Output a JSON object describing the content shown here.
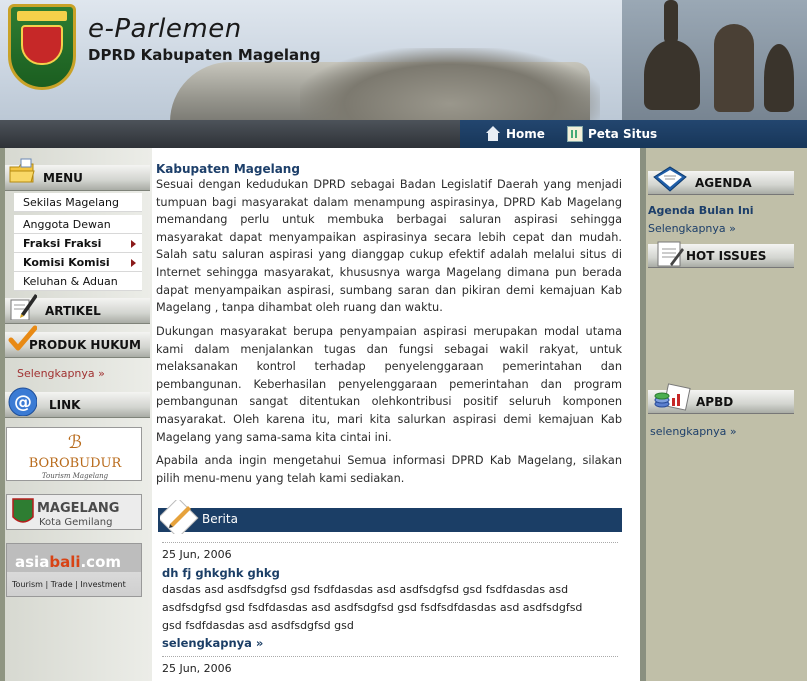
{
  "header": {
    "site_title": "e-Parlemen",
    "site_subtitle": "DPRD Kabupaten Magelang",
    "logo_label": "MAGELANG",
    "nav": [
      {
        "label": "Home",
        "icon": "home-icon"
      },
      {
        "label": "Peta Situs",
        "icon": "sitemap-icon"
      }
    ]
  },
  "left": {
    "menu_title": "MENU",
    "menu_items": [
      {
        "label": "Sekilas Magelang",
        "bold": false,
        "submenu": false
      },
      {
        "label": "Anggota Dewan",
        "bold": false,
        "submenu": false
      },
      {
        "label": "Fraksi Fraksi",
        "bold": true,
        "submenu": true
      },
      {
        "label": "Komisi Komisi",
        "bold": true,
        "submenu": true
      },
      {
        "label": "Keluhan & Aduan",
        "bold": false,
        "submenu": false
      }
    ],
    "artikel_title": "ARTIKEL",
    "produk_title": "PRODUK HUKUM",
    "produk_more": "Selengkapnya »",
    "link_title": "LINK",
    "banners": {
      "borobudur": {
        "name": "BOROBUDUR",
        "tagline": "Tourism Magelang"
      },
      "magelang": {
        "name": "MAGELANG",
        "tagline": "Kota Gemilang"
      },
      "asiabali": {
        "brand_a": "asia",
        "brand_b": "bali",
        "brand_c": ".com",
        "tagline": "Tourism | Trade | Investment"
      }
    }
  },
  "main": {
    "title": "Kabupaten Magelang",
    "paragraphs": [
      "Sesuai dengan kedudukan DPRD sebagai Badan Legislatif Daerah yang menjadi tumpuan bagi  masyarakat dalam menampung aspirasinya, DPRD Kab Magelang memandang perlu untuk membuka berbagai saluran aspirasi sehingga masyarakat dapat menyampaikan aspirasinya secara lebih cepat dan mudah.  Salah satu saluran aspirasi yang dianggap cukup efektif adalah melalui situs di Internet sehingga masyarakat, khususnya warga Magelang dimana pun berada dapat menyampaikan aspirasi, sumbang saran dan pikiran demi kemajuan Kab Magelang , tanpa dihambat oleh ruang dan waktu.",
      "Dukungan masyarakat berupa penyampaian aspirasi merupakan modal utama kami dalam menjalankan tugas dan fungsi sebagai wakil rakyat, untuk melaksanakan kontrol terhadap penyelenggaraan pemerintahan dan pembangunan.  Keberhasilan penyelenggaraan pemerintahan dan program pembangunan sangat ditentukan olehkontribusi positif seluruh komponen masyarakat. Oleh karena itu, mari kita salurkan aspirasi demi kemajuan Kab Magelang yang sama-sama kita cintai ini.",
      "Apabila anda ingin mengetahui Semua informasi DPRD Kab Magelang, silakan pilih menu-menu yang telah kami sediakan."
    ],
    "berita_title": "Berita",
    "news": [
      {
        "date": "25 Jun, 2006",
        "title": "dh fj ghkghk ghkg",
        "body": "dasdas asd asdfsdgfsd gsd fsdfdasdas asd asdfsdgfsd gsd fsdfdasdas asd asdfsdgfsd gsd fsdfdasdas asd asdfsdgfsd gsd fsdfsdfdasdas asd asdfsdgfsd gsd fsdfdasdas asd asdfsdgfsd gsd",
        "more": "selengkapnya »"
      },
      {
        "date": "25 Jun, 2006"
      }
    ]
  },
  "right": {
    "agenda_title": "AGENDA",
    "agenda_subtitle": "Agenda Bulan Ini",
    "agenda_more": "Selengkapnya »",
    "hot_title": "HOT ISSUES",
    "apbd_title": "APBD",
    "apbd_more": "selengkapnya »"
  },
  "colors": {
    "nav_bar": "#1b3e66",
    "link_red": "#a13232",
    "right_bg": "#c0bfa8"
  }
}
